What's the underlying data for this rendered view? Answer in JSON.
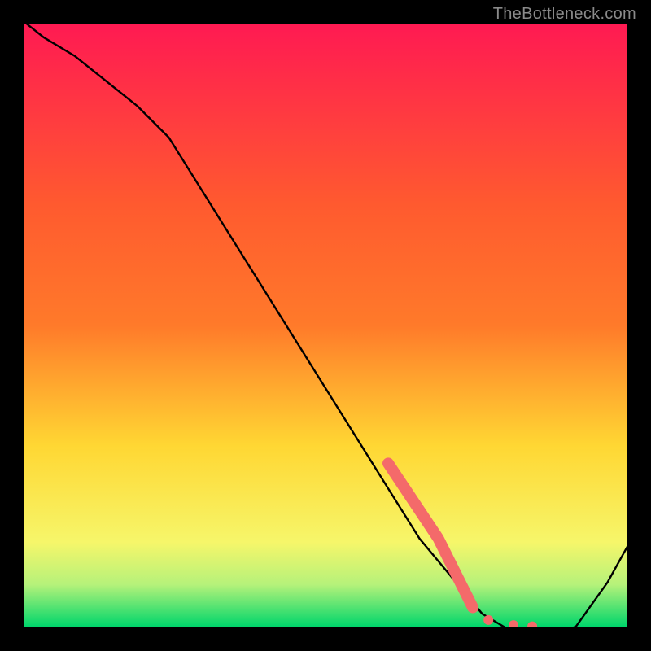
{
  "watermark": "TheBottleneck.com",
  "chart_data": {
    "type": "line",
    "title": "",
    "xlabel": "",
    "ylabel": "",
    "xlim": [
      0,
      100
    ],
    "ylim": [
      0,
      100
    ],
    "legend": false,
    "note": "Axis values are approximate percentages — the chart has no visible tick labels; curve values were read off gridlines.",
    "series": [
      {
        "name": "bottleneck-curve",
        "color": "#000000",
        "x": [
          0,
          5,
          10,
          15,
          20,
          25,
          30,
          35,
          40,
          45,
          50,
          55,
          60,
          65,
          70,
          75,
          80,
          83,
          86,
          90,
          95,
          100
        ],
        "y": [
          100,
          96,
          93,
          89,
          85,
          80,
          72,
          64,
          56,
          48,
          40,
          32,
          24,
          16,
          10,
          4,
          1,
          0,
          0,
          2,
          9,
          18
        ]
      }
    ],
    "highlight_segment": {
      "name": "thick-red-band",
      "color": "#f46a6a",
      "width": 14,
      "x": [
        60,
        62,
        64,
        66,
        68,
        70,
        72,
        73.5
      ],
      "y": [
        28,
        25,
        22,
        19,
        16,
        12,
        8,
        5
      ]
    },
    "markers": [
      {
        "x": 76,
        "y": 3.0,
        "r": 6,
        "color": "#f46a6a"
      },
      {
        "x": 80,
        "y": 2.2,
        "r": 6,
        "color": "#f46a6a"
      },
      {
        "x": 83,
        "y": 2.0,
        "r": 6,
        "color": "#f46a6a"
      }
    ],
    "background_gradient": {
      "top": "#ff1a52",
      "mid1": "#ff7a2a",
      "mid2": "#ffd733",
      "mid3": "#f6f66a",
      "bottom": "#00d66b"
    },
    "plot_box_border": "#000000",
    "plot_box_border_width": 30
  }
}
